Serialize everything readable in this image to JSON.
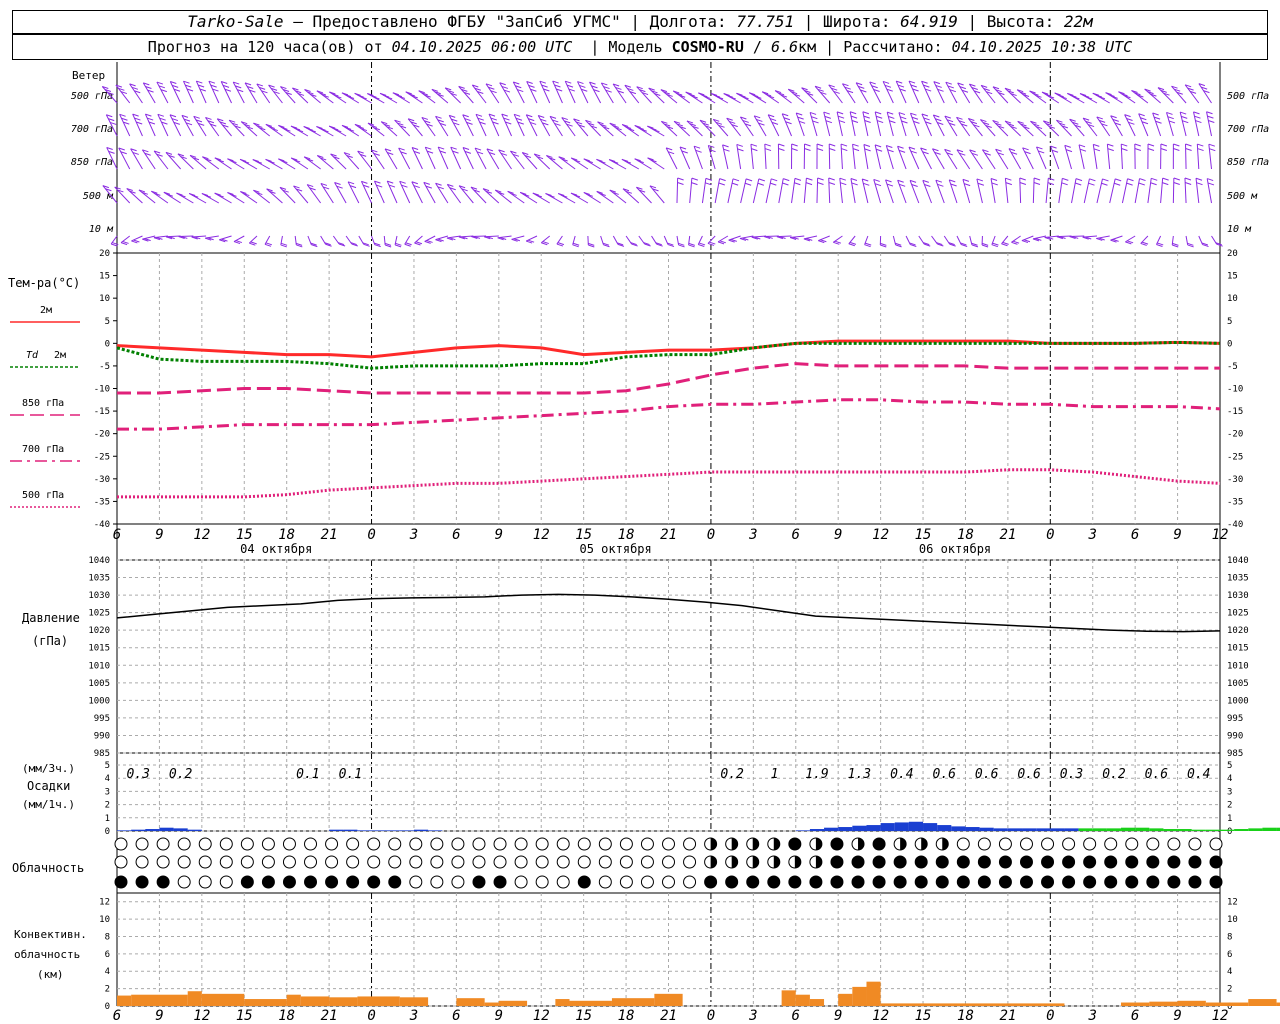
{
  "header": {
    "station": "Tarko-Sale",
    "provider": "– Предоставлено ФГБУ \"ЗапСиб УГМС\"",
    "lon_label": "Долгота:",
    "lon": "77.751",
    "lat_label": "Широта:",
    "lat": "64.919",
    "alt_label": "Высота:",
    "alt": "22м",
    "forecast_label": "Прогноз на 120 часа(ов) от",
    "forecast_start": "04.10.2025 06:00 UTC",
    "model_label": "Модель",
    "model": "COSMO-RU",
    "resolution": "6.6",
    "resolution_unit": "км",
    "calc_label": "Рассчитано:",
    "calc_time": "04.10.2025 10:38 UTC"
  },
  "colors": {
    "t2m": "#ff2a2a",
    "td2m": "#008000",
    "t850": "#e0207a",
    "pressure": "#000000",
    "wind": "#8a2be2",
    "precip3h": "#1a3fd1",
    "precip1h": "#19d019",
    "convective": "#f08a24"
  },
  "chart_data": [
    {
      "type": "wind-barbs",
      "panel": "wind",
      "title": "Ветер",
      "levels": [
        "500 гПа",
        "700 гПа",
        "850 гПа",
        "500 м",
        "10 м"
      ]
    },
    {
      "type": "line",
      "panel": "temperature",
      "ylabel": "Тем-ра(°C)",
      "ylim": [
        -40,
        20
      ],
      "yticks": [
        20,
        15,
        10,
        5,
        0,
        -5,
        -10,
        -15,
        -20,
        -25,
        -30,
        -35,
        -40
      ],
      "x_hours": [
        0,
        3,
        6,
        9,
        12,
        15,
        18,
        21,
        24,
        27,
        30,
        33,
        36,
        39,
        42,
        45,
        48,
        51,
        54,
        57,
        60,
        63,
        66,
        69,
        72,
        75,
        78
      ],
      "series": [
        {
          "name": "2м",
          "style": "solid",
          "values": [
            -0.5,
            -1,
            -1.5,
            -2,
            -2.5,
            -2.5,
            -3,
            -2,
            -1,
            -0.5,
            -1,
            -2.5,
            -2,
            -1.5,
            -1.5,
            -1,
            0,
            0.5,
            0.5,
            0.5,
            0.5,
            0.5,
            0,
            0,
            0,
            0.2,
            0
          ]
        },
        {
          "name": "Td 2м",
          "style": "dotted",
          "values": [
            -1,
            -3.5,
            -4,
            -4,
            -4,
            -4.5,
            -5.5,
            -5,
            -5,
            -5,
            -4.5,
            -4.5,
            -3,
            -2.5,
            -2.5,
            -1,
            0,
            0,
            0,
            0,
            0,
            0,
            0,
            0,
            0,
            0.2,
            0
          ]
        },
        {
          "name": "850 гПа",
          "style": "dashed",
          "values": [
            -11,
            -11,
            -10.5,
            -10,
            -10,
            -10.5,
            -11,
            -11,
            -11,
            -11,
            -11,
            -11,
            -10.5,
            -9,
            -7,
            -5.5,
            -4.5,
            -5,
            -5,
            -5,
            -5,
            -5.5,
            -5.5,
            -5.5,
            -5.5,
            -5.5,
            -5.5
          ]
        },
        {
          "name": "700 гПа",
          "style": "dashdot",
          "values": [
            -19,
            -19,
            -18.5,
            -18,
            -18,
            -18,
            -18,
            -17.5,
            -17,
            -16.5,
            -16,
            -15.5,
            -15,
            -14,
            -13.5,
            -13.5,
            -13,
            -12.5,
            -12.5,
            -13,
            -13,
            -13.5,
            -13.5,
            -14,
            -14,
            -14,
            -14.5
          ]
        },
        {
          "name": "500 гПа",
          "style": "dotted-fine",
          "values": [
            -34,
            -34,
            -34,
            -34,
            -33.5,
            -32.5,
            -32,
            -31.5,
            -31,
            -31,
            -30.5,
            -30,
            -29.5,
            -29,
            -28.5,
            -28.5,
            -28.5,
            -28.5,
            -28.5,
            -28.5,
            -28.5,
            -28,
            -28,
            -28.5,
            -29.5,
            -30.5,
            -31
          ]
        }
      ]
    },
    {
      "type": "line",
      "panel": "pressure",
      "ylabel": "Давление",
      "yunit": "(гПа)",
      "ylim": [
        985,
        1040
      ],
      "yticks": [
        1040,
        1035,
        1030,
        1025,
        1020,
        1015,
        1010,
        1005,
        1000,
        995,
        990,
        985
      ],
      "x_hours": [
        0,
        3,
        6,
        9,
        12,
        15,
        18,
        21,
        24,
        27,
        30,
        33,
        36,
        39,
        42,
        45,
        48,
        51,
        54,
        57,
        60,
        63,
        66,
        69,
        72,
        75,
        78
      ],
      "values": [
        1023.5,
        1024.5,
        1025.5,
        1026.5,
        1027,
        1027.5,
        1028.5,
        1029,
        1029.2,
        1029.3,
        1029.5,
        1030,
        1030.2,
        1030,
        1029.5,
        1028.8,
        1028,
        1027,
        1025.5,
        1024,
        1023.5,
        1023,
        1022.5,
        1022,
        1021.5,
        1021,
        1020.5,
        1020,
        1019.7,
        1019.6,
        1019.8
      ]
    },
    {
      "type": "bar",
      "panel": "precipitation",
      "ylabel": "(мм/3ч.)",
      "title": "Осадки",
      "yunit": "(мм/1ч.)",
      "ylim": [
        0,
        5
      ],
      "yticks": [
        5,
        4,
        3,
        2,
        1,
        0
      ],
      "totals_3h": [
        "0.3",
        "0.2",
        "",
        "",
        "0.1",
        "0.1",
        "",
        "",
        "",
        "",
        "",
        "",
        "",
        "",
        "0.2",
        "1",
        "1.9",
        "1.3",
        "0.4",
        "0.6",
        "0.6",
        "0.6",
        "0.3",
        "0.2",
        "0.6",
        "0.4"
      ],
      "bars": [
        {
          "h": 0,
          "v": 0.05
        },
        {
          "h": 1,
          "v": 0.1
        },
        {
          "h": 2,
          "v": 0.15
        },
        {
          "h": 3,
          "v": 0.25
        },
        {
          "h": 4,
          "v": 0.2
        },
        {
          "h": 5,
          "v": 0.1
        },
        {
          "h": 15,
          "v": 0.1
        },
        {
          "h": 16,
          "v": 0.1
        },
        {
          "h": 17,
          "v": 0.05
        },
        {
          "h": 18,
          "v": 0.05
        },
        {
          "h": 19,
          "v": 0.05
        },
        {
          "h": 20,
          "v": 0.05
        },
        {
          "h": 21,
          "v": 0.1
        },
        {
          "h": 22,
          "v": 0.05
        },
        {
          "h": 48,
          "v": 0.05
        },
        {
          "h": 49,
          "v": 0.15
        },
        {
          "h": 50,
          "v": 0.25
        },
        {
          "h": 51,
          "v": 0.3
        },
        {
          "h": 52,
          "v": 0.4
        },
        {
          "h": 53,
          "v": 0.45
        },
        {
          "h": 54,
          "v": 0.6
        },
        {
          "h": 55,
          "v": 0.65
        },
        {
          "h": 56,
          "v": 0.7
        },
        {
          "h": 57,
          "v": 0.6
        },
        {
          "h": 58,
          "v": 0.45
        },
        {
          "h": 59,
          "v": 0.35
        },
        {
          "h": 60,
          "v": 0.3
        },
        {
          "h": 61,
          "v": 0.25
        },
        {
          "h": 62,
          "v": 0.2
        },
        {
          "h": 63,
          "v": 0.2
        },
        {
          "h": 64,
          "v": 0.2
        },
        {
          "h": 65,
          "v": 0.2
        },
        {
          "h": 66,
          "v": 0.2
        },
        {
          "h": 67,
          "v": 0.2
        },
        {
          "h": 68,
          "v": 0.2,
          "c": "g"
        },
        {
          "h": 69,
          "v": 0.2,
          "c": "g"
        },
        {
          "h": 70,
          "v": 0.2,
          "c": "g"
        },
        {
          "h": 71,
          "v": 0.25,
          "c": "g"
        },
        {
          "h": 72,
          "v": 0.25,
          "c": "g"
        },
        {
          "h": 73,
          "v": 0.2,
          "c": "g"
        },
        {
          "h": 74,
          "v": 0.15,
          "c": "g"
        },
        {
          "h": 75,
          "v": 0.15,
          "c": "g"
        },
        {
          "h": 76,
          "v": 0.1,
          "c": "g"
        },
        {
          "h": 77,
          "v": 0.1,
          "c": "g"
        },
        {
          "h": 78,
          "v": 0.1,
          "c": "g"
        },
        {
          "h": 79,
          "v": 0.15,
          "c": "g"
        },
        {
          "h": 80,
          "v": 0.2,
          "c": "g"
        },
        {
          "h": 81,
          "v": 0.25,
          "c": "g"
        },
        {
          "h": 82,
          "v": 0.25,
          "c": "g"
        },
        {
          "h": 83,
          "v": 0.2
        },
        {
          "h": 84,
          "v": 0.15
        },
        {
          "h": 85,
          "v": 0.15
        },
        {
          "h": 86,
          "v": 0.15
        }
      ]
    },
    {
      "type": "cloud-symbols",
      "panel": "clouds",
      "title": "Облачность",
      "rows": [
        "high",
        "middle",
        "low"
      ]
    },
    {
      "type": "bar",
      "panel": "convective",
      "ylabel": "Конвективн.",
      "ylabel2": "облачность",
      "yunit": "(км)",
      "ylim": [
        0,
        13
      ],
      "yticks": [
        12,
        10,
        8,
        6,
        4,
        2,
        0
      ],
      "bars": [
        {
          "h0": 0,
          "h1": 1,
          "v": 1.2
        },
        {
          "h0": 1,
          "h1": 5,
          "v": 1.3
        },
        {
          "h0": 5,
          "h1": 6,
          "v": 1.7
        },
        {
          "h0": 6,
          "h1": 9,
          "v": 1.4
        },
        {
          "h0": 9,
          "h1": 12,
          "v": 0.8
        },
        {
          "h0": 12,
          "h1": 13,
          "v": 1.3
        },
        {
          "h0": 13,
          "h1": 15,
          "v": 1.1
        },
        {
          "h0": 15,
          "h1": 17,
          "v": 1.0
        },
        {
          "h0": 17,
          "h1": 20,
          "v": 1.1
        },
        {
          "h0": 20,
          "h1": 22,
          "v": 1.0
        },
        {
          "h0": 24,
          "h1": 26,
          "v": 0.9
        },
        {
          "h0": 26,
          "h1": 27,
          "v": 0.4
        },
        {
          "h0": 27,
          "h1": 29,
          "v": 0.6
        },
        {
          "h0": 31,
          "h1": 32,
          "v": 0.8
        },
        {
          "h0": 32,
          "h1": 35,
          "v": 0.6
        },
        {
          "h0": 35,
          "h1": 38,
          "v": 0.9
        },
        {
          "h0": 38,
          "h1": 40,
          "v": 1.4
        },
        {
          "h0": 47,
          "h1": 48,
          "v": 1.8
        },
        {
          "h0": 48,
          "h1": 49,
          "v": 1.3
        },
        {
          "h0": 49,
          "h1": 50,
          "v": 0.8
        },
        {
          "h0": 51,
          "h1": 52,
          "v": 1.4
        },
        {
          "h0": 52,
          "h1": 53,
          "v": 2.2
        },
        {
          "h0": 53,
          "h1": 54,
          "v": 2.8
        },
        {
          "h0": 54,
          "h1": 67,
          "v": 0.3
        },
        {
          "h0": 71,
          "h1": 73,
          "v": 0.4
        },
        {
          "h0": 73,
          "h1": 75,
          "v": 0.5
        },
        {
          "h0": 75,
          "h1": 77,
          "v": 0.6
        },
        {
          "h0": 77,
          "h1": 80,
          "v": 0.4
        },
        {
          "h0": 80,
          "h1": 82,
          "v": 0.8
        },
        {
          "h0": 82,
          "h1": 83,
          "v": 0.4
        },
        {
          "h0": 85,
          "h1": 86,
          "v": 0.9
        },
        {
          "h0": 86,
          "h1": 87,
          "v": 0.5
        }
      ]
    }
  ],
  "x_axis": {
    "time_labels": [
      "6",
      "9",
      "12",
      "15",
      "18",
      "21",
      "0",
      "3",
      "6",
      "9",
      "12",
      "15",
      "18",
      "21",
      "0",
      "3",
      "6",
      "9",
      "12",
      "15",
      "18",
      "21",
      "0",
      "3",
      "6",
      "9",
      "12"
    ],
    "days": [
      "04 октября",
      "05 октября",
      "06 октября"
    ]
  }
}
